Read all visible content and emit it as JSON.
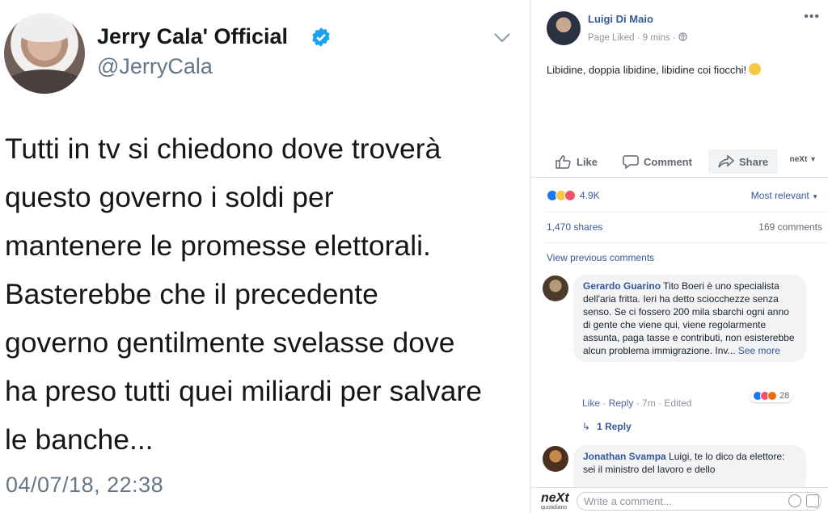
{
  "tweet": {
    "display_name": "Jerry Cala' Official",
    "handle": "@JerryCala",
    "text_lines": [
      "Tutti in tv si chiedono dove troverà",
      "questo governo i soldi per",
      "mantenere le promesse elettorali.",
      "Basterebbe che il precedente",
      "governo gentilmente svelasse dove",
      "ha preso tutti quei miliardi per salvare",
      "le banche..."
    ],
    "timestamp": "04/07/18, 22:38",
    "colors": {
      "verified": "#1da1f2",
      "secondary_text": "#657786"
    }
  },
  "facebook": {
    "page_name": "Luigi Di Maio",
    "meta": "Page Liked · 9 mins ·",
    "post_text": "Libidine, doppia libidine, libidine coi fiocchi!",
    "actions": {
      "like": "Like",
      "comment": "Comment",
      "share": "Share",
      "page_badge": "neXt"
    },
    "reactions_count": "4.9K",
    "sort_label": "Most relevant",
    "shares": "1,470 shares",
    "comments_count": "169 comments",
    "view_previous": "View previous comments",
    "comments": [
      {
        "author": "Gerardo Guarino",
        "text": " Tito Boeri è uno specialista dell'aria fritta. Ieri ha detto sciocchezze senza senso. Se ci fossero 200 mila sbarchi ogni anno di gente che viene qui, viene regolarmente assunta, paga tasse e contributi, non esisterebbe alcun problema immigrazione. Inv...",
        "see_more": "See more",
        "like": "Like",
        "reply": "Reply",
        "time": "7m",
        "edited": "Edited",
        "reaction_count": "28",
        "replies": "1 Reply"
      },
      {
        "author": "Jonathan Svampa",
        "text": " Luigi, te lo dico da elettore: sei il ministro del lavoro e dello"
      }
    ],
    "composer": {
      "placeholder": "Write a comment...",
      "brand": "neXt",
      "brand_sub": "quotidiano"
    },
    "colors": {
      "link": "#365899",
      "meta": "#90949c",
      "bubble": "#f2f3f5"
    }
  }
}
